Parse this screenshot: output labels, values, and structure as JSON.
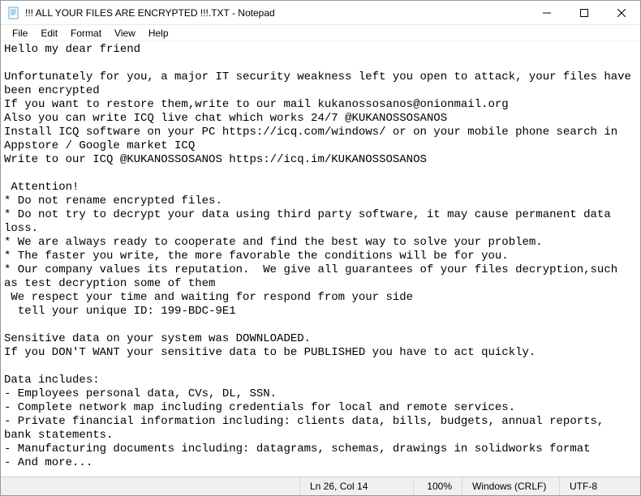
{
  "window": {
    "title": "!!! ALL YOUR FILES ARE ENCRYPTED !!!.TXT - Notepad"
  },
  "menu": {
    "file": "File",
    "edit": "Edit",
    "format": "Format",
    "view": "View",
    "help": "Help"
  },
  "document": {
    "text": "Hello my dear friend\n\nUnfortunately for you, a major IT security weakness left you open to attack, your files have been encrypted\nIf you want to restore them,write to our mail kukanossosanos@onionmail.org\nAlso you can write ICQ live chat which works 24/7 @KUKANOSSOSANOS\nInstall ICQ software on your PC https://icq.com/windows/ or on your mobile phone search in Appstore / Google market ICQ\nWrite to our ICQ @KUKANOSSOSANOS https://icq.im/KUKANOSSOSANOS\n\n Attention!\n* Do not rename encrypted files.\n* Do not try to decrypt your data using third party software, it may cause permanent data loss.\n* We are always ready to cooperate and find the best way to solve your problem.\n* The faster you write, the more favorable the conditions will be for you.\n* Our company values its reputation.  We give all guarantees of your files decryption,such as test decryption some of them\n We respect your time and waiting for respond from your side\n  tell your unique ID: 199-BDC-9E1\n\nSensitive data on your system was DOWNLOADED.\nIf you DON'T WANT your sensitive data to be PUBLISHED you have to act quickly.\n\nData includes:\n- Employees personal data, CVs, DL, SSN.\n- Complete network map including credentials for local and remote services.\n- Private financial information including: clients data, bills, budgets, annual reports, bank statements.\n- Manufacturing documents including: datagrams, schemas, drawings in solidworks format\n- And more..."
  },
  "status": {
    "position": "Ln 26, Col 14",
    "zoom": "100%",
    "line_ending": "Windows (CRLF)",
    "encoding": "UTF-8"
  }
}
